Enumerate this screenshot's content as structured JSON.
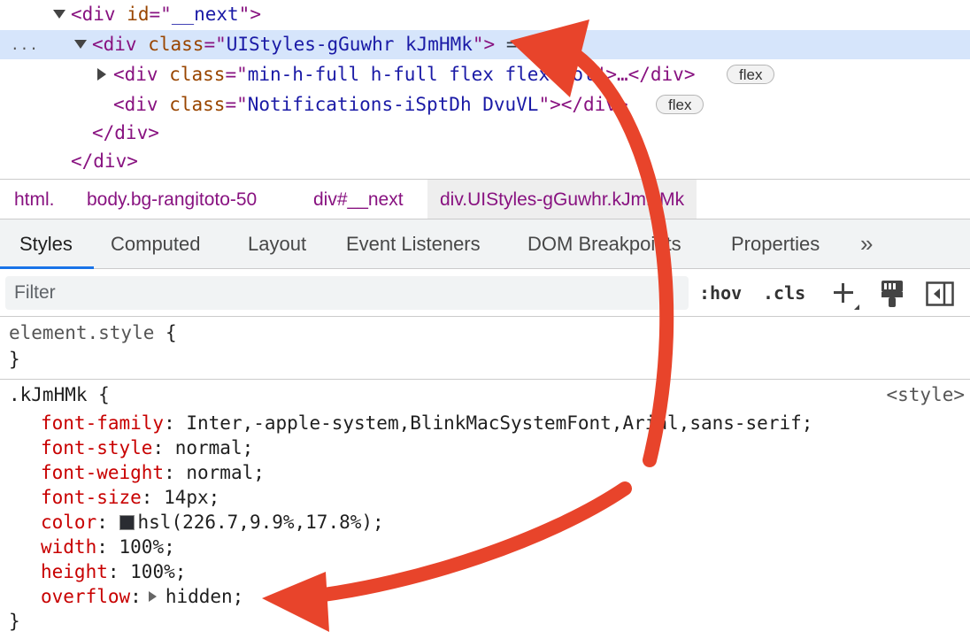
{
  "dom_tree": {
    "rows": [
      {
        "open": "<div ",
        "attr": "id",
        "eq": "=\"",
        "val": "__next",
        "close": "\">"
      },
      {
        "open": "<div ",
        "attr": "class",
        "eq": "=\"",
        "val": "UIStyles-gGuwhr kJmHMk",
        "close": "\">",
        "suffix": " == $0",
        "ellipsis": "..."
      },
      {
        "open": "<div ",
        "attr": "class",
        "eq": "=\"",
        "val": "min-h-full h-full flex flex-col",
        "close": "\">…</div>",
        "badge": "flex"
      },
      {
        "open": "<div ",
        "attr": "class",
        "eq": "=\"",
        "val": "Notifications-iSptDh DvuVL",
        "close": "\"></div>",
        "badge": "flex"
      },
      {
        "text": "</div>"
      },
      {
        "text": "</div>"
      }
    ]
  },
  "breadcrumbs": [
    "html.",
    "body.bg-rangitoto-50",
    "div#__next",
    "div.UIStyles-gGuwhr.kJmHMk"
  ],
  "tabs": [
    "Styles",
    "Computed",
    "Layout",
    "Event Listeners",
    "DOM Breakpoints",
    "Properties"
  ],
  "tabs_more": "»",
  "filter": {
    "placeholder": "Filter",
    "hov_label": ":hov",
    "cls_label": ".cls"
  },
  "styles": {
    "element_style": {
      "selector": "element.style",
      "open": " {",
      "close": "}"
    },
    "rule": {
      "selector": ".kJmHMk",
      "open": " {",
      "close": "}",
      "source": "<style>",
      "declarations": [
        {
          "name": "font-family",
          "value": "Inter,-apple-system,BlinkMacSystemFont,Arial,sans-serif;"
        },
        {
          "name": "font-style",
          "value": "normal;"
        },
        {
          "name": "font-weight",
          "value": "normal;"
        },
        {
          "name": "font-size",
          "value": "14px;"
        },
        {
          "name": "color",
          "value": "hsl(226.7,9.9%,17.8%);",
          "swatch": "#2a2c32"
        },
        {
          "name": "width",
          "value": "100%;"
        },
        {
          "name": "height",
          "value": "100%;"
        },
        {
          "name": "overflow",
          "value": "hidden;",
          "expandable": true
        }
      ]
    }
  },
  "colors": {
    "selection_bg": "#d6e5fb",
    "tab_accent": "#1a73e8",
    "annotation_arrow": "#e8442b"
  }
}
